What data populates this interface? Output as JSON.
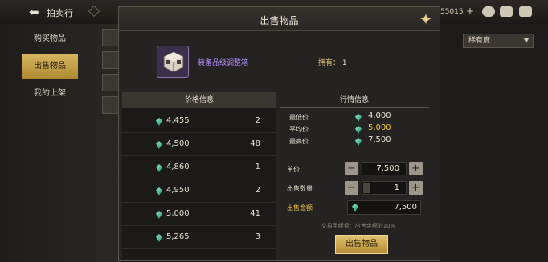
{
  "top_bar": {
    "back_icon": "arrow-left-icon",
    "title": "拍卖行",
    "currency_text": "55015",
    "colors": {
      "accent_gold": "#d6b560",
      "purple_item": "#b08cff",
      "gold_text": "#f0c24a"
    }
  },
  "left_tabs": [
    {
      "label": "购买物品"
    },
    {
      "label": "出售物品",
      "active": true
    },
    {
      "label": "我的上架"
    }
  ],
  "sort_dropdown": {
    "selected": "稀有度"
  },
  "modal": {
    "title": "出售物品",
    "item": {
      "name": "装备品级调整箱",
      "icon": "cube-box-icon"
    },
    "owned_label": "拥有：",
    "owned_count": "1",
    "price_list": {
      "header": "价格信息",
      "rows": [
        {
          "price": "4,455",
          "qty": "2"
        },
        {
          "price": "4,500",
          "qty": "48"
        },
        {
          "price": "4,860",
          "qty": "1"
        },
        {
          "price": "4,950",
          "qty": "2"
        },
        {
          "price": "5,000",
          "qty": "41"
        },
        {
          "price": "5,265",
          "qty": "3"
        }
      ]
    },
    "market": {
      "header": "行情信息",
      "lowest_label": "最低价",
      "lowest": "4,000",
      "average_label": "平均价",
      "average": "5,000",
      "highest_label": "最高价",
      "highest": "7,500"
    },
    "form": {
      "unit_price_label": "单价",
      "unit_price": "7,500",
      "quantity_label": "出售数量",
      "quantity": "1",
      "total_label": "出售金额",
      "total": "7,500",
      "fee_note": "交易手续费：出售金额的10%",
      "sell_button": "出售物品"
    }
  }
}
